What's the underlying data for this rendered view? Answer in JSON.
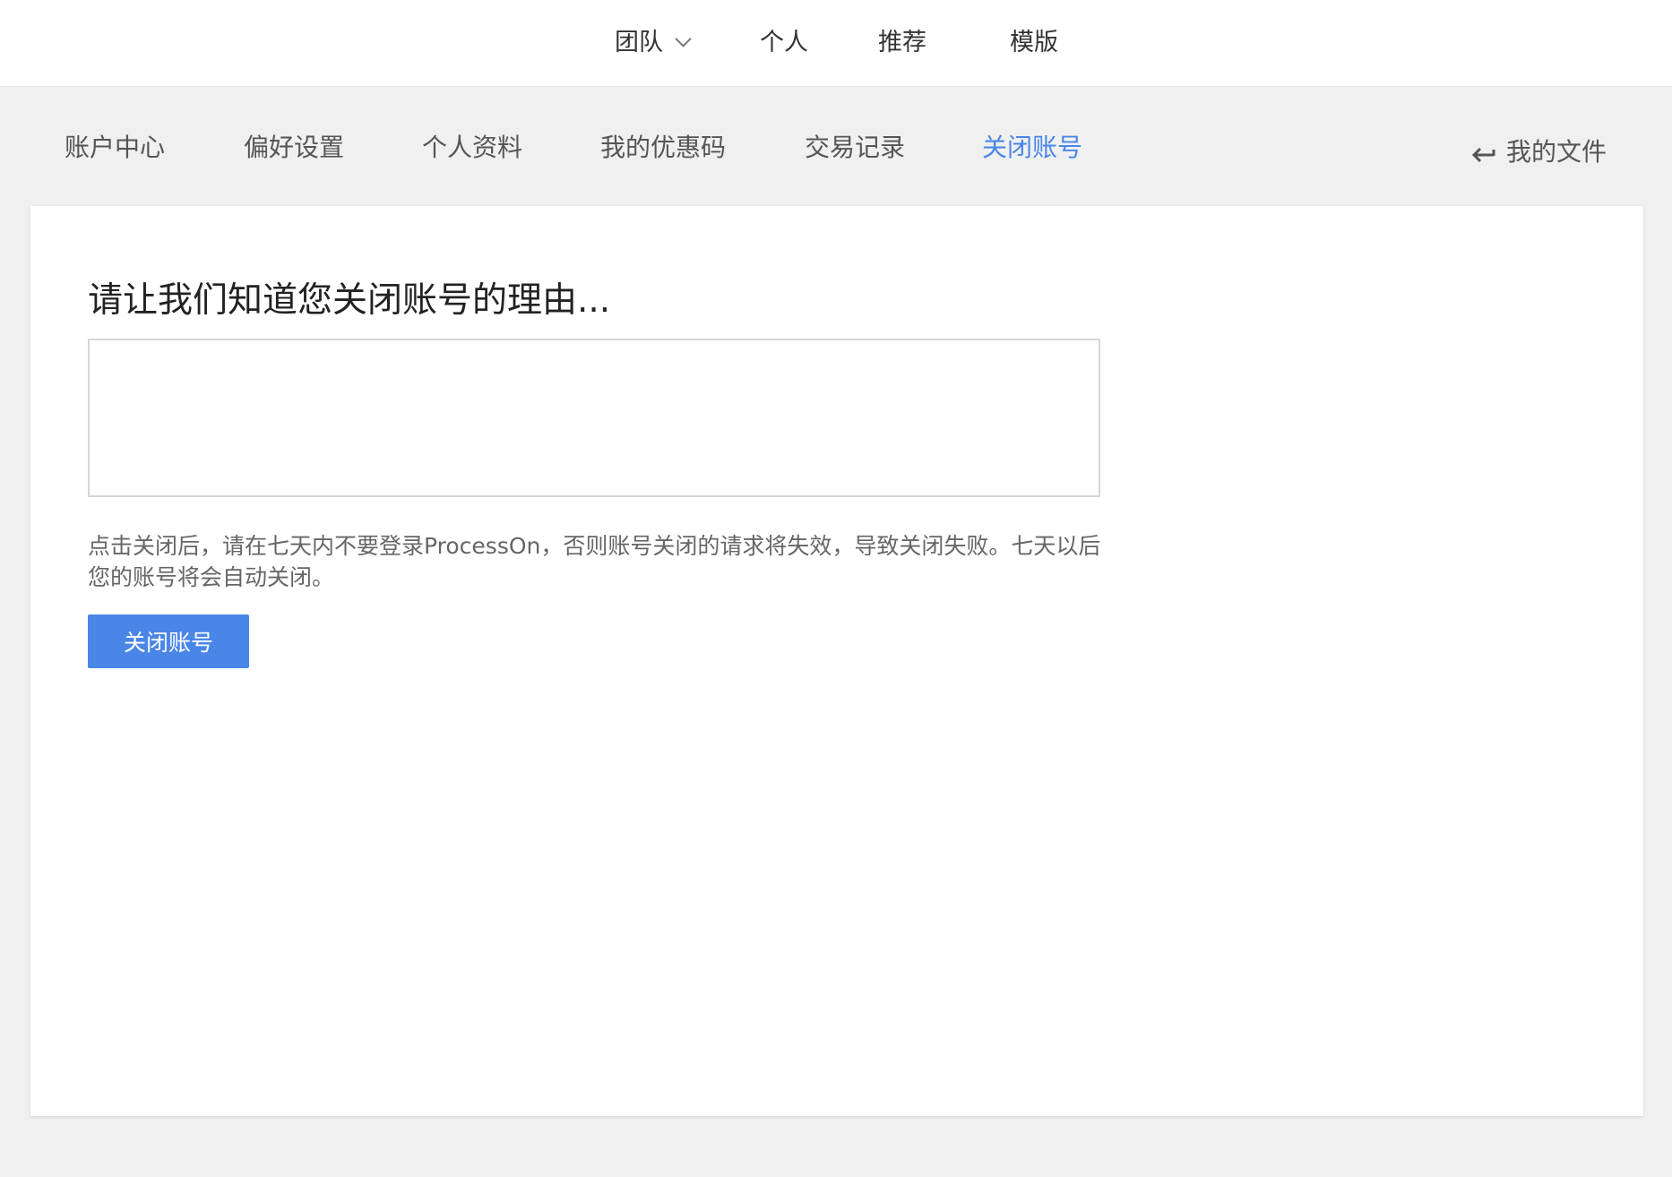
{
  "top_nav": {
    "items": [
      {
        "label": "团队",
        "has_dropdown": true
      },
      {
        "label": "个人"
      },
      {
        "label": "推荐"
      },
      {
        "label": "模版"
      }
    ]
  },
  "account_nav": {
    "items": [
      {
        "label": "账户中心"
      },
      {
        "label": "偏好设置"
      },
      {
        "label": "个人资料"
      },
      {
        "label": "我的优惠码"
      },
      {
        "label": "交易记录"
      },
      {
        "label": "关闭账号",
        "active": true
      }
    ],
    "my_files_label": "我的文件"
  },
  "close_account": {
    "title": "请让我们知道您关闭账号的理由...",
    "reason_value": "",
    "notice": "点击关闭后，请在七天内不要登录ProcessOn，否则账号关闭的请求将失效，导致关闭失败。七天以后您的账号将会自动关闭。",
    "button_label": "关闭账号"
  },
  "colors": {
    "accent": "#4a86e8",
    "page_bg": "#f0f0f0",
    "panel_bg": "#ffffff"
  },
  "icons": {
    "team_dropdown": "chevron-down-icon",
    "my_files": "return-arrow-icon"
  }
}
